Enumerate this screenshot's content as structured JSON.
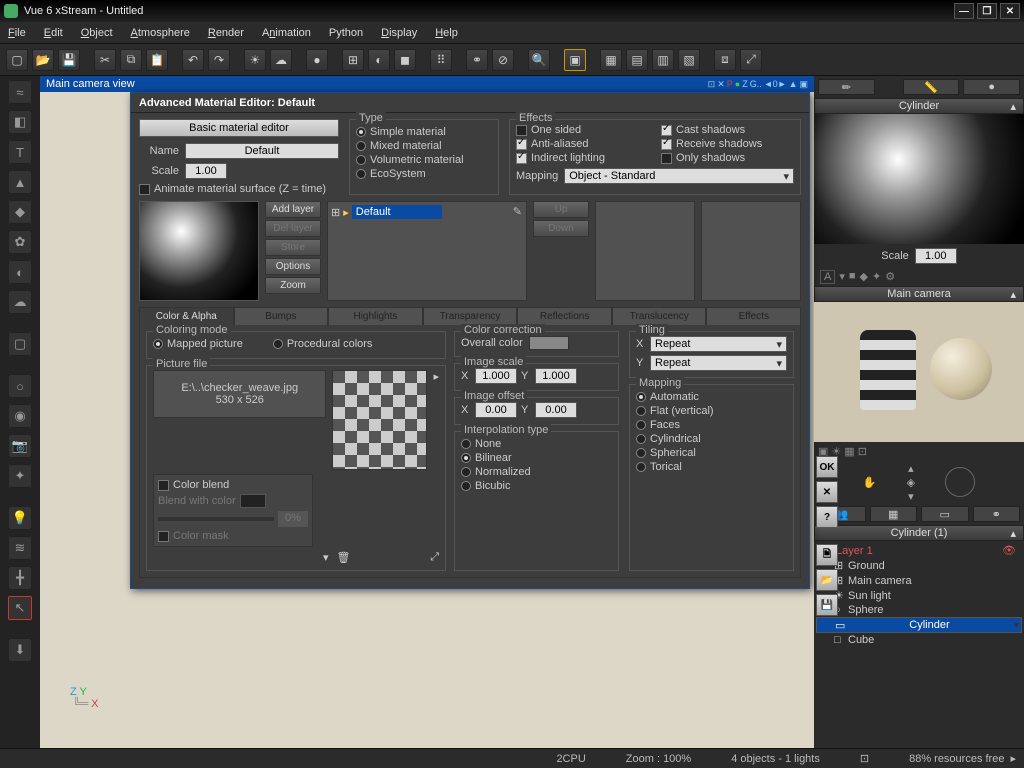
{
  "title": "Vue 6 xStream - Untitled",
  "menu": [
    "File",
    "Edit",
    "Object",
    "Atmosphere",
    "Render",
    "Animation",
    "Python",
    "Display",
    "Help"
  ],
  "viewport_header": "Main camera view",
  "dialog": {
    "title": "Advanced Material Editor: Default",
    "basic_btn": "Basic material editor",
    "name_label": "Name",
    "name_value": "Default",
    "scale_label": "Scale",
    "scale_value": "1.00",
    "animate": "Animate material surface (Z = time)",
    "type_legend": "Type",
    "type_opts": [
      "Simple material",
      "Mixed material",
      "Volumetric material",
      "EcoSystem"
    ],
    "effects_legend": "Effects",
    "effects_left": [
      "One sided",
      "Anti-aliased",
      "Indirect lighting"
    ],
    "effects_right": [
      "Cast shadows",
      "Receive shadows",
      "Only shadows"
    ],
    "mapping_label": "Mapping",
    "mapping_value": "Object - Standard",
    "layer_btns": [
      "Add layer",
      "Del layer",
      "Store",
      "Options",
      "Zoom"
    ],
    "layer_name": "Default",
    "up": "Up",
    "down": "Down",
    "tabs": [
      "Color & Alpha",
      "Bumps",
      "Highlights",
      "Transparency",
      "Reflections",
      "Translucency",
      "Effects"
    ],
    "coloring_legend": "Coloring mode",
    "coloring_opts": [
      "Mapped picture",
      "Procedural colors"
    ],
    "picfile_legend": "Picture file",
    "picfile_path": "E:\\..\\checker_weave.jpg",
    "picfile_dims": "530 x 526",
    "color_blend": "Color blend",
    "blend_with": "Blend with color",
    "blend_pct": "0%",
    "color_mask": "Color mask",
    "colorcorr_legend": "Color correction",
    "overall_color": "Overall color",
    "imgscale_legend": "Image scale",
    "imgoffset_legend": "Image offset",
    "imgscale_x": "1.000",
    "imgscale_y": "1.000",
    "imgoffset_x": "0.00",
    "imgoffset_y": "0.00",
    "interp_legend": "Interpolation type",
    "interp_opts": [
      "None",
      "Bilinear",
      "Normalized",
      "Bicubic"
    ],
    "tiling_legend": "Tiling",
    "tiling_x": "Repeat",
    "tiling_y": "Repeat",
    "mapping_legend": "Mapping",
    "mapping_opts": [
      "Automatic",
      "Flat (vertical)",
      "Faces",
      "Cylindrical",
      "Spherical",
      "Torical"
    ],
    "ok": "OK"
  },
  "right": {
    "obj_name": "Cylinder",
    "scale_label": "Scale",
    "scale_value": "1.00",
    "cam_name": "Main camera",
    "world_name": "Cylinder (1)",
    "tree": [
      {
        "label": "Layer 1",
        "cls": "layer"
      },
      {
        "label": "Ground",
        "icon": "⊞"
      },
      {
        "label": "Main camera",
        "icon": "⊞"
      },
      {
        "label": "Sun light",
        "icon": "☀"
      },
      {
        "label": "Sphere",
        "icon": "○"
      },
      {
        "label": "Cylinder",
        "icon": "▭",
        "sel": true
      },
      {
        "label": "Cube",
        "icon": "□"
      }
    ]
  },
  "status": {
    "cpu": "2CPU",
    "zoom": "Zoom : 100%",
    "objs": "4 objects - 1 lights",
    "res": "88% resources free"
  }
}
